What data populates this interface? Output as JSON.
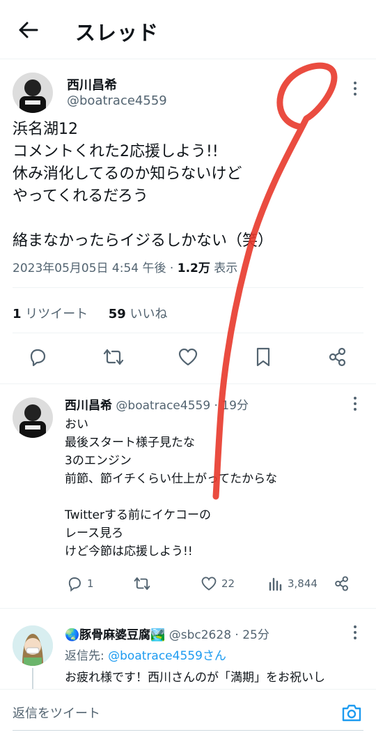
{
  "header": {
    "title": "スレッド"
  },
  "main_tweet": {
    "display_name": "西川昌希",
    "handle": "@boatrace4559",
    "text": "浜名湖12\nコメントくれた2応援しよう!!\n休み消化してるのか知らないけど\nやってくれるだろう\n\n絡まなかったらイジるしかない（笑）",
    "timestamp": "2023年05月05日 4:54 午後 · ",
    "views_count": "1.2万",
    "views_label": " 表示",
    "retweets_count": "1",
    "retweets_label": " リツイート",
    "likes_count": "59",
    "likes_label": " いいね"
  },
  "reply1": {
    "display_name": "西川昌希",
    "handle": " @boatrace4559 · 19分",
    "text": "おい\n最後スタート様子見たな\n3のエンジン\n前節、節イチくらい仕上がってたからな\n\nTwitterする前にイケコーの\nレース見ろ\nけど今節は応援しよう!!",
    "replies": "1",
    "likes": "22",
    "views": "3,844"
  },
  "reply2": {
    "display_name": "🌏豚骨麻婆豆腐🏞️",
    "handle": " @sbc2628 · 25分",
    "reply_to_label": "返信先: ",
    "reply_to_handle": "@boatrace4559さん",
    "text": "お疲れ様です！西川さんのが「満期」をお祝いし"
  },
  "reply_bar": {
    "placeholder": "返信をツイート"
  },
  "colors": {
    "accent": "#1d9bf0",
    "annotation": "#e8392b"
  }
}
